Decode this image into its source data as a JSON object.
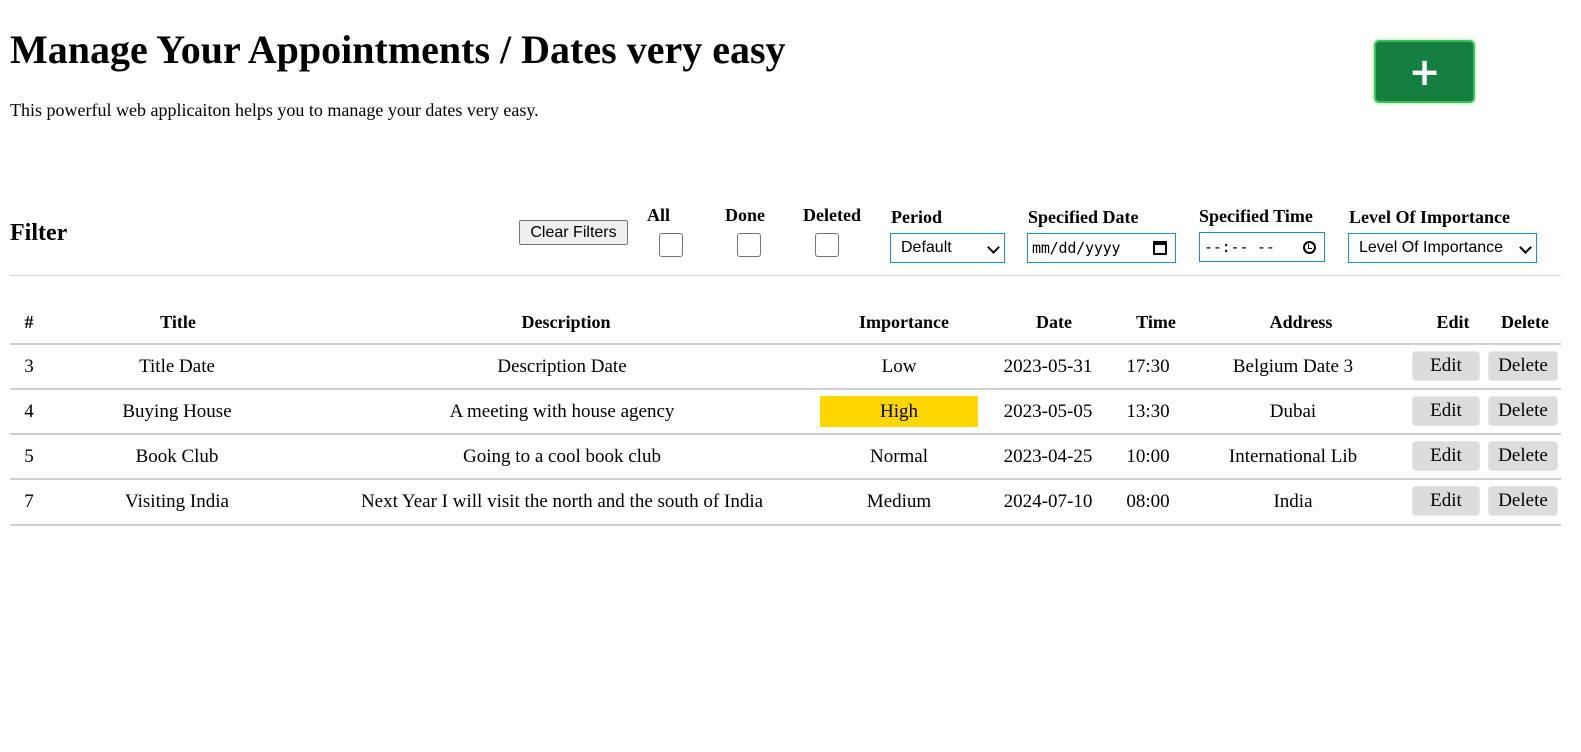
{
  "header": {
    "title": "Manage Your Appointments / Dates very easy",
    "subtitle": "This powerful web applicaiton helps you to manage your dates very easy.",
    "add_button_label": "+"
  },
  "filter": {
    "heading": "Filter",
    "clear_button_label": "Clear Filters",
    "all_label": "All",
    "done_label": "Done",
    "deleted_label": "Deleted",
    "period_label": "Period",
    "period_value": "Default",
    "specified_date_label": "Specified Date",
    "specified_date_placeholder": "mm/dd/yyyy",
    "specified_time_label": "Specified Time",
    "specified_time_placeholder": "--:-- --",
    "importance_label": "Level Of Importance",
    "importance_value": "Level Of Importance"
  },
  "table": {
    "columns": {
      "index": "#",
      "title": "Title",
      "description": "Description",
      "importance": "Importance",
      "date": "Date",
      "time": "Time",
      "address": "Address",
      "edit": "Edit",
      "delete": "Delete"
    },
    "rows": [
      {
        "id": "3",
        "title": "Title Date",
        "description": "Description Date",
        "importance": "Low",
        "date": "2023-05-31",
        "time": "17:30",
        "address": "Belgium Date 3",
        "edit": "Edit",
        "delete": "Delete"
      },
      {
        "id": "4",
        "title": "Buying House",
        "description": "A meeting with house agency",
        "importance": "High",
        "date": "2023-05-05",
        "time": "13:30",
        "address": "Dubai",
        "edit": "Edit",
        "delete": "Delete"
      },
      {
        "id": "5",
        "title": "Book Club",
        "description": "Going to a cool book club",
        "importance": "Normal",
        "date": "2023-04-25",
        "time": "10:00",
        "address": "International Lib",
        "edit": "Edit",
        "delete": "Delete"
      },
      {
        "id": "7",
        "title": "Visiting India",
        "description": "Next Year I will visit the north and the south of India",
        "importance": "Medium",
        "date": "2024-07-10",
        "time": "08:00",
        "address": "India",
        "edit": "Edit",
        "delete": "Delete"
      }
    ]
  },
  "colors": {
    "add_button": "#157f40",
    "high_importance": "#ffd700",
    "input_border": "#1a8cd8"
  }
}
